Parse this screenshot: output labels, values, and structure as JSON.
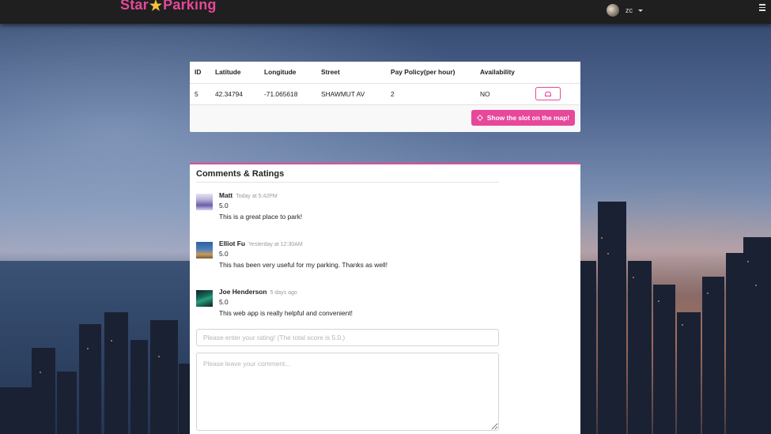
{
  "navbar": {
    "brand_left": "Star",
    "brand_star": "★",
    "brand_right": "Parking",
    "user_name": "zc"
  },
  "slot": {
    "headers": [
      "ID",
      "Latitude",
      "Longitude",
      "Street",
      "Pay Policy(per hour)",
      "Availability"
    ],
    "row": [
      "5",
      "42.34794",
      "-71.065618",
      "SHAWMUT AV",
      "2",
      "NO"
    ],
    "show_map_label": "Show the slot on the map!"
  },
  "comments": {
    "title": "Comments & Ratings",
    "items": [
      {
        "author": "Matt",
        "time": "Today at 5:42PM",
        "rating": "5.0",
        "text": "This is a great place to park!",
        "avatar_colors": [
          "#b9b3d8",
          "#6a5da8"
        ]
      },
      {
        "author": "Elliot Fu",
        "time": "Yesterday at 12:30AM",
        "rating": "5.0",
        "text": "This has been very useful for my parking. Thanks as well!",
        "avatar_colors": [
          "#3a6fb0",
          "#c89a5a"
        ]
      },
      {
        "author": "Joe Henderson",
        "time": "5 days ago",
        "rating": "5.0",
        "text": "This web app is really helpful and convenient!",
        "avatar_colors": [
          "#1a6a5a",
          "#0c1f2a"
        ]
      }
    ],
    "rating_placeholder": "Please enter your rating! (The total score is 5.0.)",
    "comment_placeholder": "Please leave your comment..."
  },
  "colors": {
    "accent": "#e7489a",
    "navbar": "#1f1f1f",
    "star": "#f6c23a"
  }
}
